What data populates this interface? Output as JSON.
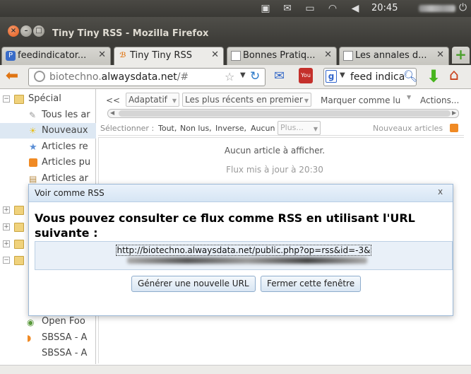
{
  "top_panel": {
    "clock": "20:45"
  },
  "window": {
    "title": "Tiny Tiny RSS - Mozilla Firefox"
  },
  "tabs": [
    {
      "label": "feedindicator..."
    },
    {
      "label": "Tiny Tiny RSS"
    },
    {
      "label": "Bonnes Pratiq..."
    },
    {
      "label": "Les annales d..."
    }
  ],
  "navbar": {
    "url_host": "biotechno.",
    "url_domain": "alwaysdata.net",
    "url_path": "/#",
    "search_text": "feed indica"
  },
  "sidebar": {
    "special_label": "Spécial",
    "items": [
      {
        "label": "Tous les ar"
      },
      {
        "label": "Nouveaux"
      },
      {
        "label": "Articles re"
      },
      {
        "label": "Articles pu"
      },
      {
        "label": "Articles ar"
      }
    ],
    "bottom_items": [
      {
        "label": "Open Foo"
      },
      {
        "label": "SBSSA - A"
      },
      {
        "label": "SBSSA - A"
      }
    ]
  },
  "toolbar": {
    "collapse": "<<",
    "view_mode": "Adaptatif",
    "order": "Les plus récents en premier",
    "mark_as": "Marquer comme lu",
    "actions": "Actions..."
  },
  "selection_bar": {
    "label": "Sélectionner :",
    "all": "Tout,",
    "unread": "Non lus,",
    "invert": "Inverse,",
    "none": "Aucun",
    "more": "Plus...",
    "new_articles": "Nouveaux articles"
  },
  "articles": {
    "empty": "Aucun article à afficher.",
    "updated": "Flux mis à jour à 20:30"
  },
  "dialog": {
    "title": "Voir comme RSS",
    "close": "x",
    "heading": "Vous pouvez consulter ce flux comme RSS en utilisant l'URL suivante :",
    "url": "http://biotechno.alwaysdata.net/public.php?op=rss&id=-3&",
    "btn_new_url": "Générer une nouvelle URL",
    "btn_close": "Fermer cette fenêtre"
  },
  "colors": {
    "dialog_header": "#d6e5f4",
    "url_box": "#e9f0f8",
    "firefox_orange": "#e07412"
  }
}
